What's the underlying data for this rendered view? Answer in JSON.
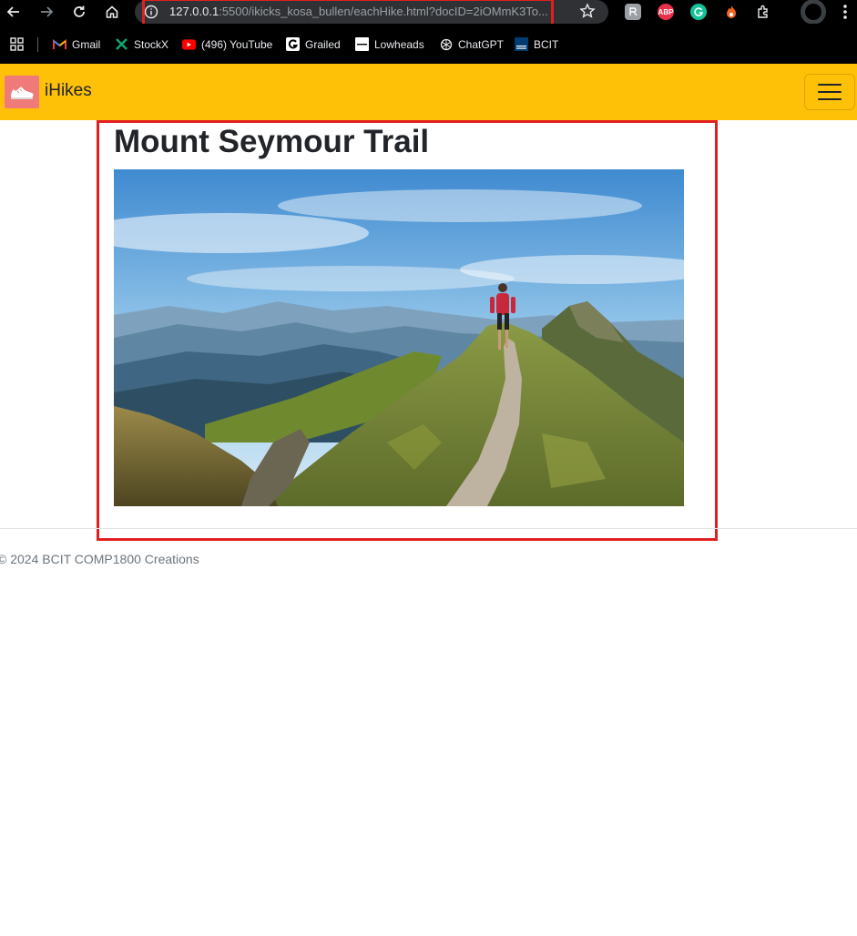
{
  "browser": {
    "url_host": "127.0.0.1",
    "url_rest": ":5500/ikicks_kosa_bullen/eachHike.html?docID=2iOMmK3To...",
    "extensions": [
      "ABP"
    ],
    "bookmarks": [
      {
        "label": "Gmail",
        "icon": "gmail-icon"
      },
      {
        "label": "StockX",
        "icon": "stockx-icon"
      },
      {
        "label": "(496) YouTube",
        "icon": "youtube-icon"
      },
      {
        "label": "Grailed",
        "icon": "grailed-icon"
      },
      {
        "label": "Lowheads",
        "icon": "lowheads-icon"
      },
      {
        "label": "ChatGPT",
        "icon": "chatgpt-icon"
      },
      {
        "label": "BCIT",
        "icon": "bcit-icon"
      }
    ]
  },
  "navbar": {
    "brand": "iHikes",
    "color": "#ffc107"
  },
  "hike": {
    "title": "Mount Seymour Trail",
    "image_alt": "hiker-on-mountain-ridge-photo"
  },
  "footer": {
    "text": "© 2024 BCIT COMP1800 Creations"
  },
  "colors": {
    "highlight": "#e02020"
  }
}
